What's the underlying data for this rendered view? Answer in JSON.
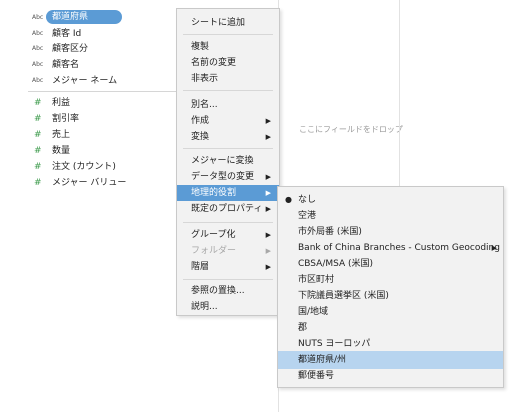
{
  "dimensions": [
    {
      "type": "Abc",
      "name": "都道府県"
    },
    {
      "type": "Abc",
      "name": "顧客 Id"
    },
    {
      "type": "Abc",
      "name": "顧客区分"
    },
    {
      "type": "Abc",
      "name": "顧客名"
    },
    {
      "type": "Abc",
      "name": "メジャー ネーム"
    }
  ],
  "measures": [
    {
      "type": "#",
      "name": "利益"
    },
    {
      "type": "#",
      "name": "割引率"
    },
    {
      "type": "#",
      "name": "売上"
    },
    {
      "type": "#",
      "name": "数量"
    },
    {
      "type": "#",
      "name": "注文 (カウント)"
    },
    {
      "type": "#",
      "name": "メジャー バリュー"
    }
  ],
  "drop_zone": {
    "text": "ここにフィールドをドロップ"
  },
  "context_menu": {
    "items": [
      {
        "label": "シートに追加"
      },
      {
        "label": "複製"
      },
      {
        "label": "名前の変更"
      },
      {
        "label": "非表示"
      },
      {
        "label": "別名..."
      },
      {
        "label": "作成",
        "arrow": "▶"
      },
      {
        "label": "変換",
        "arrow": "▶"
      },
      {
        "label": "メジャーに変換"
      },
      {
        "label": "データ型の変更",
        "arrow": "▶"
      },
      {
        "label": "地理的役割",
        "arrow": "▶"
      },
      {
        "label": "既定のプロパティ",
        "arrow": "▶"
      },
      {
        "label": "グループ化",
        "arrow": "▶"
      },
      {
        "label": "フォルダー",
        "arrow": "▶"
      },
      {
        "label": "階層",
        "arrow": "▶"
      },
      {
        "label": "参照の置換..."
      },
      {
        "label": "説明..."
      }
    ]
  },
  "geo_submenu": {
    "items": [
      {
        "label": "なし",
        "mark": "●"
      },
      {
        "label": "空港"
      },
      {
        "label": "市外局番 (米国)"
      },
      {
        "label": "Bank of China Branches - Custom Geocoding",
        "arrow": "▶"
      },
      {
        "label": "CBSA/MSA (米国)"
      },
      {
        "label": "市区町村"
      },
      {
        "label": "下院議員選挙区 (米国)"
      },
      {
        "label": "国/地域"
      },
      {
        "label": "郡"
      },
      {
        "label": "NUTS ヨーロッパ"
      },
      {
        "label": "都道府県/州"
      },
      {
        "label": "郵便番号"
      }
    ]
  },
  "colors": {
    "selection": "#5b9bd5",
    "submenu_highlight": "#b7d4ef",
    "measure_icon": "#3b9a4a"
  }
}
